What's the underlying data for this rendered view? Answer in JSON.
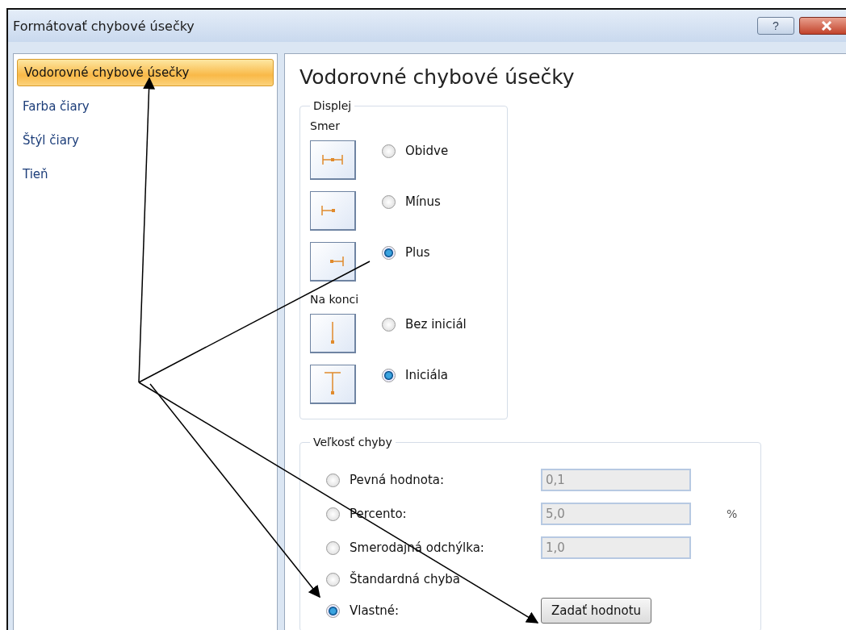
{
  "window": {
    "title": "Formátovať chybové úsečky",
    "help_button": "?"
  },
  "sidebar": {
    "items": [
      {
        "label": "Vodorovné chybové úsečky",
        "selected": true
      },
      {
        "label": "Farba čiary",
        "selected": false
      },
      {
        "label": "Štýl čiary",
        "selected": false
      },
      {
        "label": "Tieň",
        "selected": false
      }
    ]
  },
  "panel": {
    "title": "Vodorovné chybové úsečky",
    "display": {
      "legend": "Displej",
      "direction": {
        "label": "Smer",
        "options": [
          {
            "label": "Obidve",
            "kind": "both",
            "selected": false
          },
          {
            "label": "Mínus",
            "kind": "minus",
            "selected": false
          },
          {
            "label": "Plus",
            "kind": "plus",
            "selected": true
          }
        ]
      },
      "end_style": {
        "label": "Na konci",
        "options": [
          {
            "label": "Bez iniciál",
            "kind": "nocap",
            "selected": false
          },
          {
            "label": "Iniciála",
            "kind": "cap",
            "selected": true
          }
        ]
      }
    },
    "error_amount": {
      "legend": "Veľkosť chyby",
      "options": [
        {
          "label": "Pevná hodnota:",
          "kind": "field",
          "value": "0,1",
          "disabled": true,
          "selected": false
        },
        {
          "label": "Percento:",
          "kind": "field",
          "value": "5,0",
          "unit": "%",
          "disabled": true,
          "selected": false
        },
        {
          "label": "Smerodajná odchýlka:",
          "kind": "field",
          "value": "1,0",
          "disabled": true,
          "selected": false
        },
        {
          "label": "Štandardná chyba",
          "kind": "plain",
          "selected": false
        },
        {
          "label": "Vlastné:",
          "kind": "button",
          "button": "Zadať hodnotu",
          "selected": true
        }
      ]
    }
  }
}
